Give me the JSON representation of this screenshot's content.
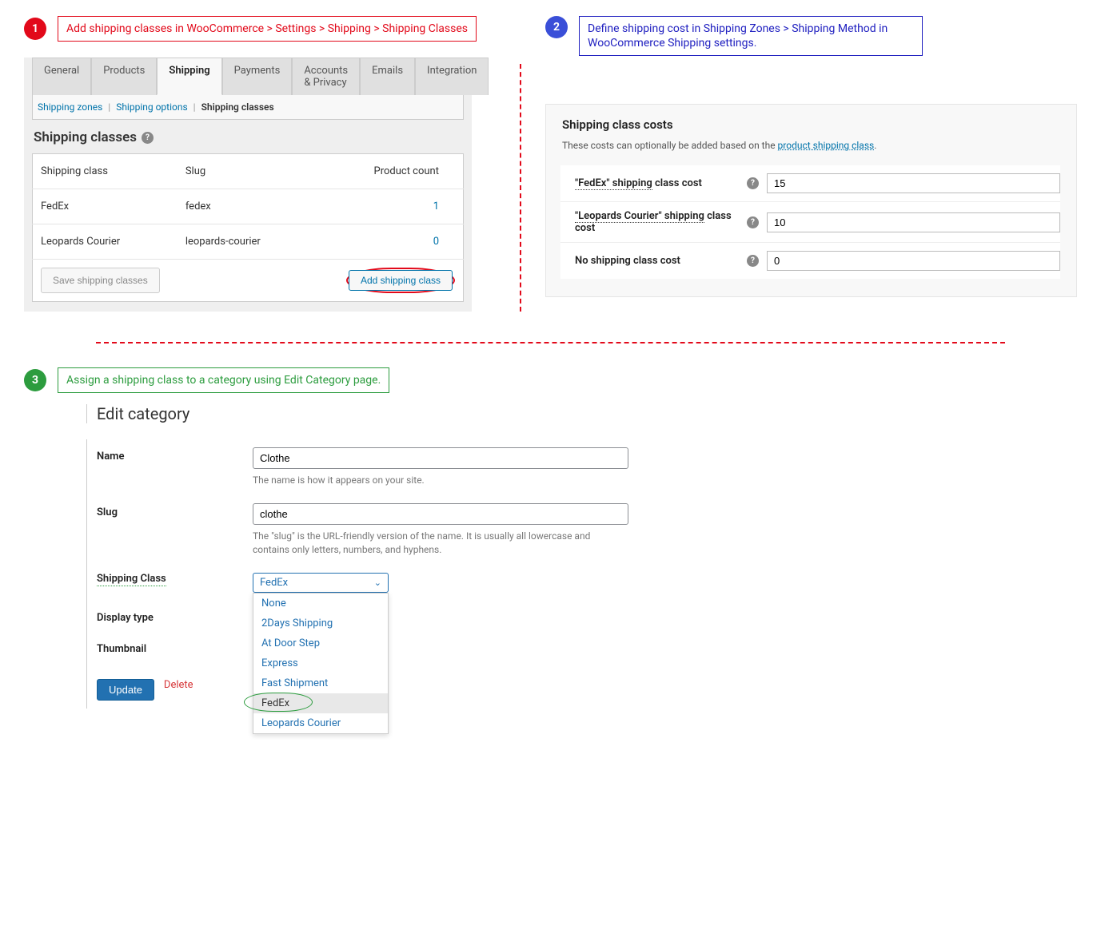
{
  "step1": {
    "num": "1",
    "text": "Add shipping classes in WooCommerce > Settings > Shipping > Shipping Classes"
  },
  "step2": {
    "num": "2",
    "text": "Define shipping cost in Shipping Zones > Shipping Method in WooCommerce Shipping settings."
  },
  "step3": {
    "num": "3",
    "text": "Assign a shipping class to a category using Edit Category page."
  },
  "tabs": {
    "general": "General",
    "products": "Products",
    "shipping": "Shipping",
    "payments": "Payments",
    "accounts": "Accounts & Privacy",
    "emails": "Emails",
    "integration": "Integration"
  },
  "subnav": {
    "zones": "Shipping zones",
    "options": "Shipping options",
    "classes": "Shipping classes"
  },
  "panel1": {
    "heading": "Shipping classes",
    "col1": "Shipping class",
    "col2": "Slug",
    "col3": "Product count",
    "rows": [
      {
        "name": "FedEx",
        "slug": "fedex",
        "count": "1"
      },
      {
        "name": "Leopards Courier",
        "slug": "leopards-courier",
        "count": "0"
      }
    ],
    "save": "Save shipping classes",
    "add": "Add shipping class"
  },
  "panel2": {
    "heading": "Shipping class costs",
    "desc_pre": "These costs can optionally be added based on the ",
    "desc_link": "product shipping class",
    "desc_post": ".",
    "rows": [
      {
        "label_q": "\"FedEx\" shipping",
        "label_r": " class cost",
        "value": "15"
      },
      {
        "label_q": "\"Leopards Courier\" shipping",
        "label_r": " class cost",
        "value": "10"
      },
      {
        "label_q": "No shipping class cost",
        "label_r": "",
        "value": "0"
      }
    ]
  },
  "panel3": {
    "heading": "Edit category",
    "name_label": "Name",
    "name_value": "Clothe",
    "name_hint": "The name is how it appears on your site.",
    "slug_label": "Slug",
    "slug_value": "clothe",
    "slug_hint": "The \"slug\" is the URL-friendly version of the name. It is usually all lowercase and contains only letters, numbers, and hyphens.",
    "sc_label": "Shipping Class",
    "sc_selected": "FedEx",
    "options": [
      "None",
      "2Days Shipping",
      "At Door Step",
      "Express",
      "Fast Shipment",
      "FedEx",
      "Leopards Courier"
    ],
    "display_label": "Display type",
    "thumb_label": "Thumbnail",
    "update": "Update",
    "delete": "Delete"
  }
}
